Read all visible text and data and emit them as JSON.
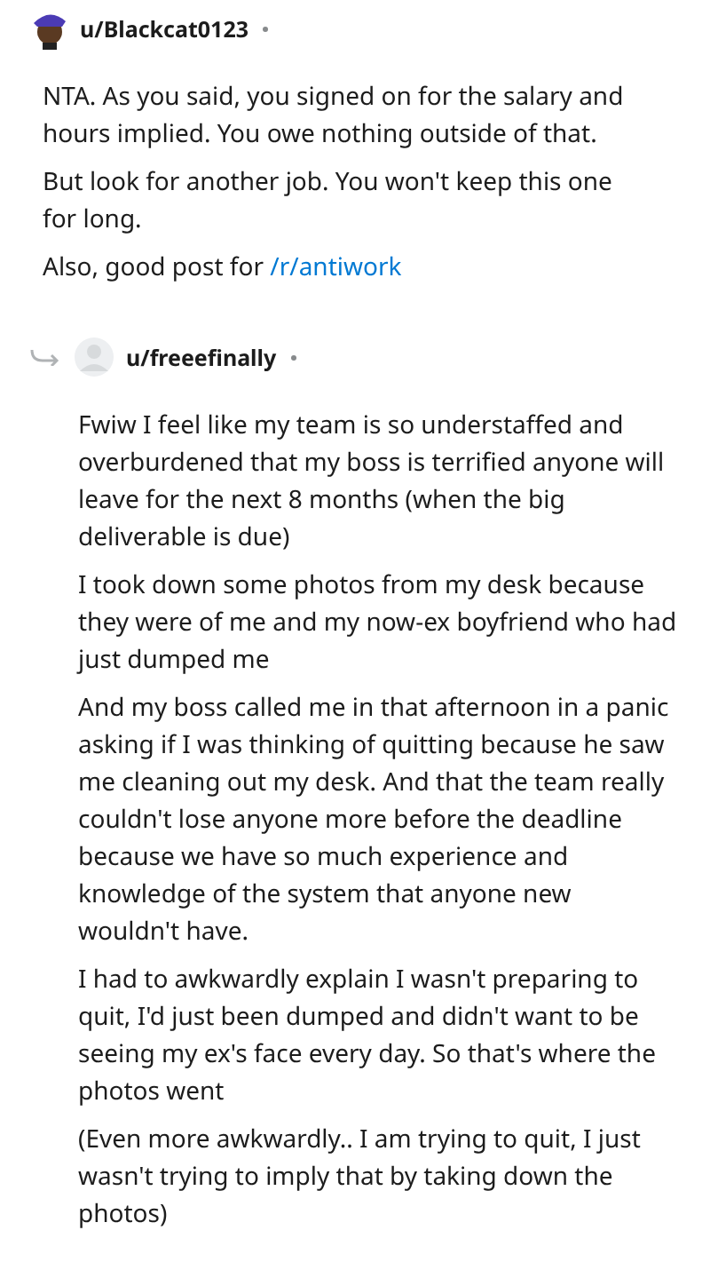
{
  "comments": [
    {
      "username": "u/Blackcat0123",
      "kind": "hat",
      "reply": false,
      "paragraphs": [
        "NTA. As you said, you signed on for the salary and hours implied. You owe nothing outside of that.",
        "But look for another job. You won't keep this one for long.",
        {
          "text": "Also, good post for ",
          "link": "/r/antiwork"
        }
      ]
    },
    {
      "username": "u/freeefinally",
      "kind": "default",
      "reply": true,
      "paragraphs": [
        "Fwiw I feel like my team is so understaffed and overburdened that my boss is terrified anyone will leave for the next 8 months (when the big deliverable is due)",
        "I took down some photos from my desk because they were of me and my now-ex boyfriend who had just dumped me",
        "And my boss called me in that afternoon in a panic asking if I was thinking of quitting because he saw me cleaning out my desk. And that the team really couldn't lose anyone more before the deadline because we have so much experience and knowledge of the system that anyone new wouldn't have.",
        "I had to awkwardly explain I wasn't preparing to quit, I'd just been dumped and didn't want to be seeing my ex's face every day. So that's where the photos went",
        "(Even more awkwardly.. I am trying to quit, I just wasn't trying to imply that by taking down the photos)"
      ]
    }
  ]
}
